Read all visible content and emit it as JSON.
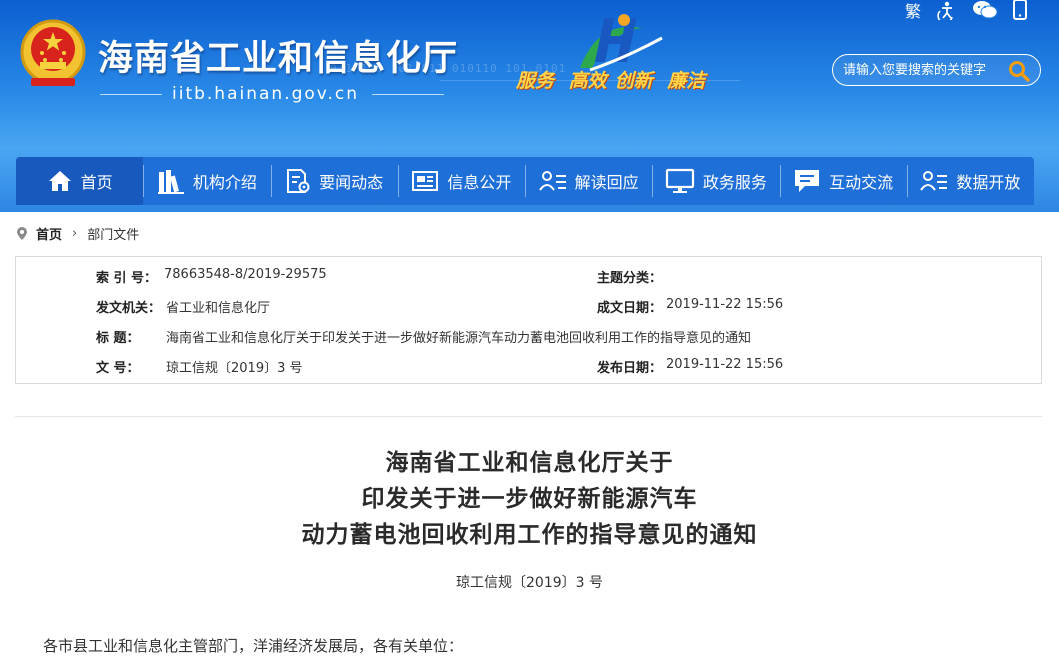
{
  "header": {
    "site_title": "海南省工业和信息化厅",
    "domain": "iitb.hainan.gov.cn",
    "slogan": [
      "服务",
      "高效",
      "创新",
      "廉洁"
    ],
    "bits_text": "0  1   110  101  011  010110  101  0101",
    "utilities": [
      {
        "label": "繁",
        "icon": "traditional-chinese-icon"
      },
      {
        "icon": "accessibility-icon"
      },
      {
        "icon": "wechat-icon"
      },
      {
        "icon": "mobile-icon"
      }
    ],
    "search": {
      "placeholder": "请输入您要搜索的关键字"
    }
  },
  "colors": {
    "header_blue": "#1f6fd8",
    "slogan_yellow": "#ffd54a",
    "search_icon": "#f39c12"
  },
  "nav": [
    {
      "label": "首页",
      "icon": "home-icon"
    },
    {
      "label": "机构介绍",
      "icon": "books-icon"
    },
    {
      "label": "要闻动态",
      "icon": "document-gear-icon"
    },
    {
      "label": "信息公开",
      "icon": "newspaper-icon"
    },
    {
      "label": "解读回应",
      "icon": "user-list-icon"
    },
    {
      "label": "政务服务",
      "icon": "monitor-icon"
    },
    {
      "label": "互动交流",
      "icon": "chat-icon"
    },
    {
      "label": "数据开放",
      "icon": "user-list-icon"
    }
  ],
  "breadcrumb": {
    "home": "首页",
    "current": "部门文件"
  },
  "info": {
    "index_label": "索  引 号：",
    "index_value": "78663548-8/2019-29575",
    "topic_label": "主题分类：",
    "topic_value": "",
    "issuer_label": "发文机关：",
    "issuer_value": "省工业和信息化厅",
    "created_label": "成文日期：",
    "created_value": "2019-11-22 15:56",
    "title_label": "标      题：",
    "title_value": "海南省工业和信息化厅关于印发关于进一步做好新能源汽车动力蓄电池回收利用工作的指导意见的通知",
    "docno_label": "文      号：",
    "docno_value": "琼工信规〔2019〕3 号",
    "published_label": "发布日期：",
    "published_value": "2019-11-22 15:56"
  },
  "document": {
    "title_lines": [
      "海南省工业和信息化厅关于",
      "印发关于进一步做好新能源汽车",
      "动力蓄电池回收利用工作的指导意见的通知"
    ],
    "doc_number": "琼工信规〔2019〕3 号",
    "salutation": "各市县工业和信息化主管部门，洋浦经济发展局，各有关单位："
  }
}
